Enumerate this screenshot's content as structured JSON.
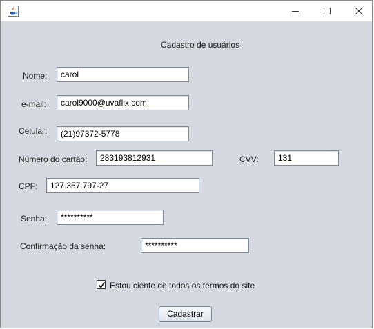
{
  "window": {
    "title": ""
  },
  "icons": {
    "app": "java-cup-icon",
    "minimize": "minimize-icon",
    "maximize": "maximize-icon",
    "close": "close-icon"
  },
  "form": {
    "title": "Cadastro de usuários",
    "nome": {
      "label": "Nome:",
      "value": "carol"
    },
    "email": {
      "label": "e-mail:",
      "value": "carol9000@uvaflix.com"
    },
    "celular": {
      "label": "Celular:",
      "value": "(21)97372-5778"
    },
    "cartao": {
      "label": "Número do cartão:",
      "value": "283193812931"
    },
    "cvv": {
      "label": "CVV:",
      "value": "131"
    },
    "cpf": {
      "label": "CPF:",
      "value": "127.357.797-27"
    },
    "senha": {
      "label": "Senha:",
      "value": "**********"
    },
    "confirmacao": {
      "label": "Confirmação da senha:",
      "value": "**********"
    },
    "termos": {
      "label": "Estou ciente de todos os termos do site",
      "checked": true
    },
    "submit_label": "Cadastrar"
  }
}
